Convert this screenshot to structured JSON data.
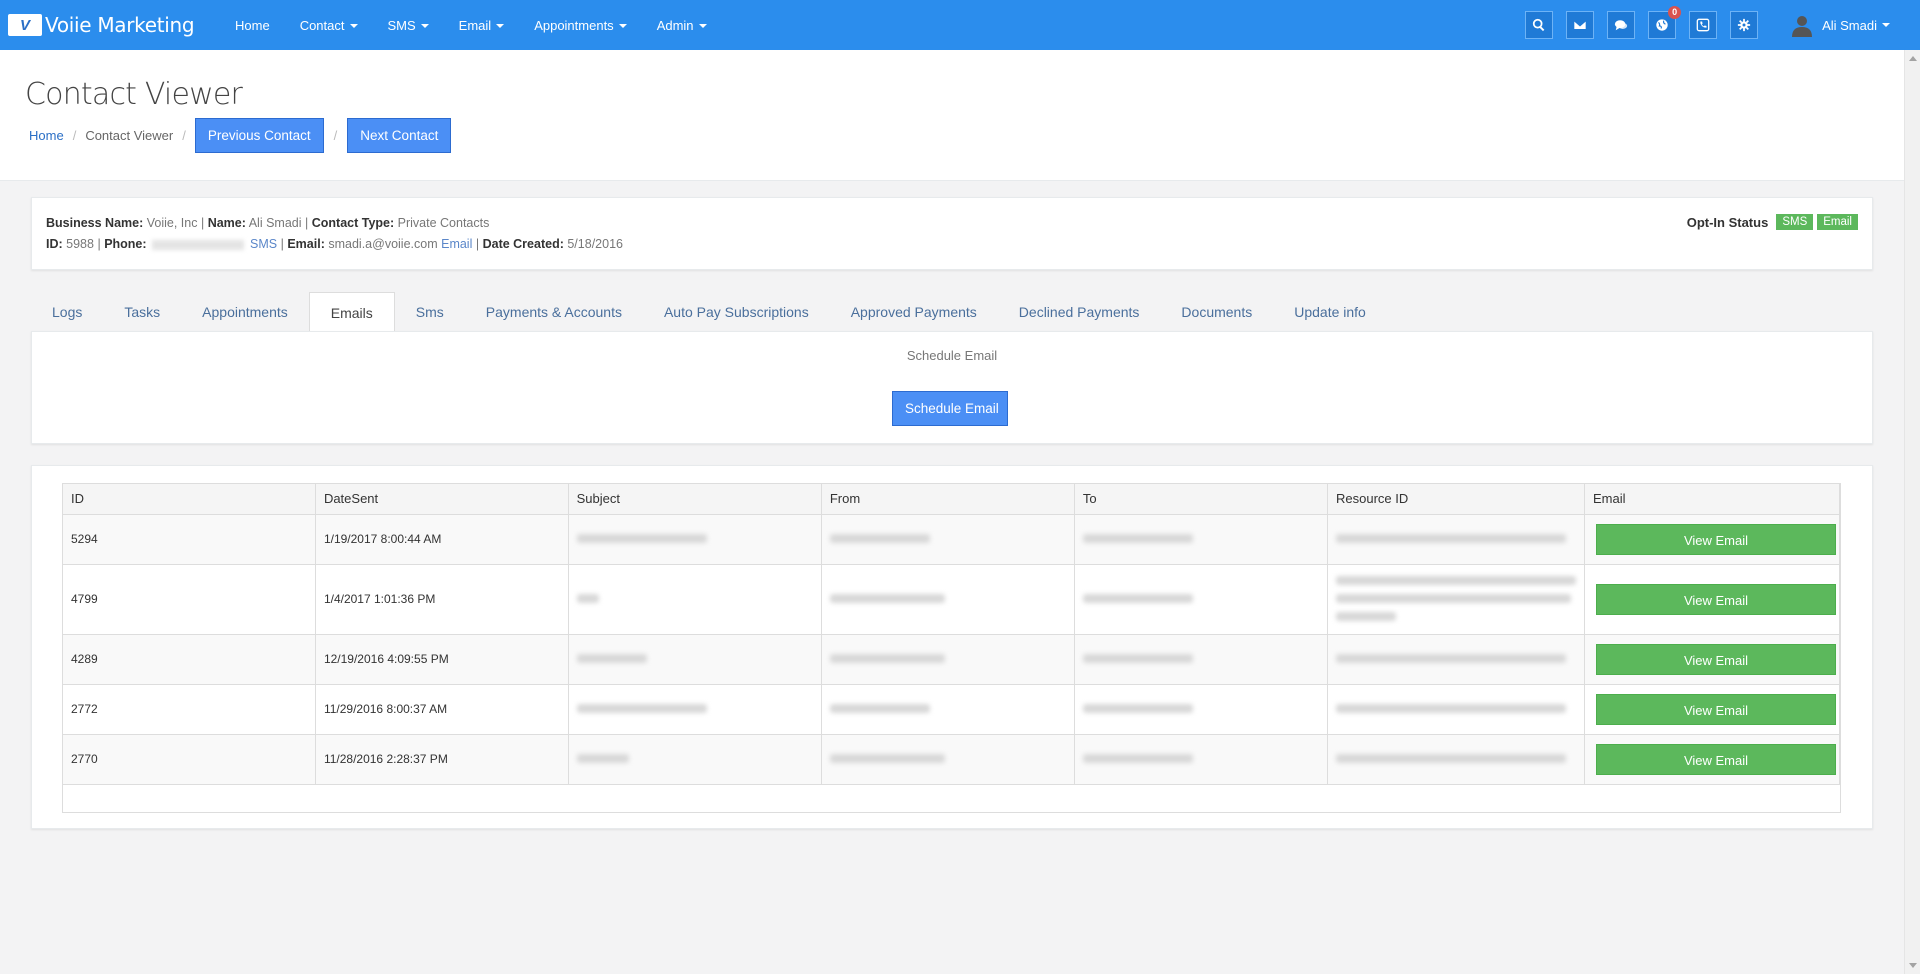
{
  "brand": {
    "logo": "V",
    "name": "Voiie Marketing"
  },
  "nav": {
    "items": [
      {
        "label": "Home",
        "dropdown": false
      },
      {
        "label": "Contact",
        "dropdown": true
      },
      {
        "label": "SMS",
        "dropdown": true
      },
      {
        "label": "Email",
        "dropdown": true
      },
      {
        "label": "Appointments",
        "dropdown": true
      },
      {
        "label": "Admin",
        "dropdown": true
      }
    ],
    "icons": [
      "search-icon",
      "envelope-icon",
      "chat-icon",
      "globe-icon",
      "phone-icon",
      "gear-icon"
    ],
    "notification_count": "0",
    "user_name": "Ali Smadi"
  },
  "header": {
    "title": "Contact Viewer",
    "breadcrumb_home": "Home",
    "breadcrumb_current": "Contact Viewer",
    "separator": "/",
    "previous_label": "Previous Contact",
    "next_label": "Next Contact"
  },
  "contact": {
    "business_name_label": "Business Name:",
    "business_name": "Voiie, Inc",
    "name_label": "Name:",
    "name": "Ali Smadi",
    "contact_type_label": "Contact Type:",
    "contact_type": "Private Contacts",
    "id_label": "ID:",
    "id": "5988",
    "phone_label": "Phone:",
    "phone_sms_link": "SMS",
    "email_label": "Email",
    "email": "smadi.a@voiie.com",
    "email_link": "Email",
    "date_created_label": "Date Created:",
    "date_created": "5/18/2016",
    "divider": "|",
    "optin_label": "Opt-In Status",
    "optin_sms": "SMS",
    "optin_email": "Email"
  },
  "tabs": [
    {
      "label": "Logs",
      "active": false
    },
    {
      "label": "Tasks",
      "active": false
    },
    {
      "label": "Appointments",
      "active": false
    },
    {
      "label": "Emails",
      "active": true
    },
    {
      "label": "Sms",
      "active": false
    },
    {
      "label": "Payments & Accounts",
      "active": false
    },
    {
      "label": "Auto Pay Subscriptions",
      "active": false
    },
    {
      "label": "Approved Payments",
      "active": false
    },
    {
      "label": "Declined Payments",
      "active": false
    },
    {
      "label": "Documents",
      "active": false
    },
    {
      "label": "Update info",
      "active": false
    }
  ],
  "panel": {
    "label": "Schedule Email",
    "button_label": "Schedule Email"
  },
  "table": {
    "columns": [
      "ID",
      "DateSent",
      "Subject",
      "From",
      "To",
      "Resource ID",
      "Email"
    ],
    "view_label": "View Email",
    "rows": [
      {
        "id": "5294",
        "date_sent": "1/19/2017 8:00:44 AM"
      },
      {
        "id": "4799",
        "date_sent": "1/4/2017 1:01:36 PM"
      },
      {
        "id": "4289",
        "date_sent": "12/19/2016 4:09:55 PM"
      },
      {
        "id": "2772",
        "date_sent": "11/29/2016 8:00:37 AM"
      },
      {
        "id": "2770",
        "date_sent": "11/28/2016 2:28:37 PM"
      }
    ]
  },
  "colors": {
    "navbar": "#2b8ded",
    "primary_button": "#4b8ff5",
    "success": "#5cb85c",
    "badge": "#d9534f"
  }
}
